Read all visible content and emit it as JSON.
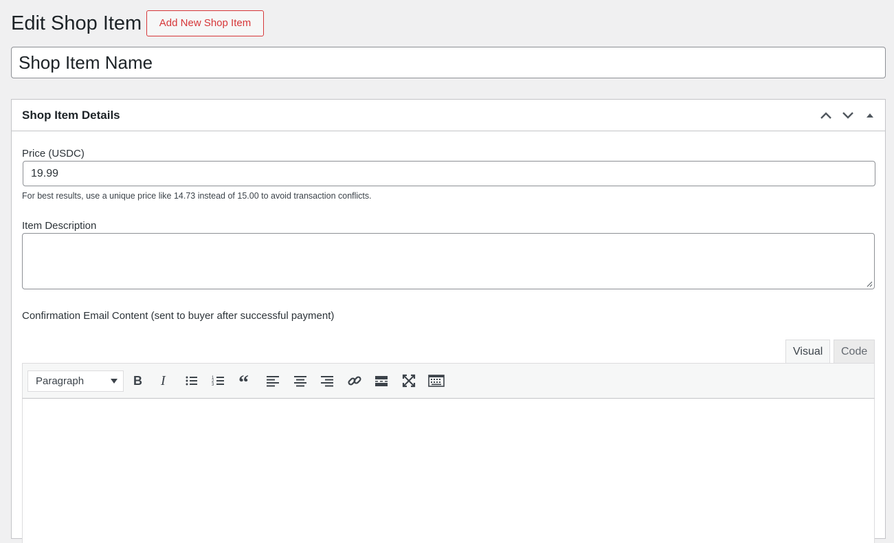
{
  "header": {
    "title": "Edit Shop Item",
    "add_new_label": "Add New Shop Item"
  },
  "title_field": {
    "value": "Shop Item Name"
  },
  "metabox": {
    "title": "Shop Item Details",
    "controls": [
      "chevron-up-icon",
      "chevron-down-icon",
      "triangle-up-icon"
    ]
  },
  "price": {
    "label": "Price (USDC)",
    "value": "19.99",
    "help": "For best results, use a unique price like 14.73 instead of 15.00 to avoid transaction conflicts."
  },
  "description": {
    "label": "Item Description",
    "value": ""
  },
  "email": {
    "label": "Confirmation Email Content (sent to buyer after successful payment)",
    "tabs": [
      "Visual",
      "Code"
    ],
    "active_tab": "Visual",
    "format_selected": "Paragraph",
    "toolbar_icons": [
      "bold-icon",
      "italic-icon",
      "bullet-list-icon",
      "numbered-list-icon",
      "blockquote-icon",
      "align-left-icon",
      "align-center-icon",
      "align-right-icon",
      "link-icon",
      "read-more-icon",
      "fullscreen-icon",
      "toolbar-toggle-icon"
    ]
  },
  "colors": {
    "accent_red": "#d63638",
    "background": "#f0f0f1",
    "icon": "#3c434a"
  }
}
